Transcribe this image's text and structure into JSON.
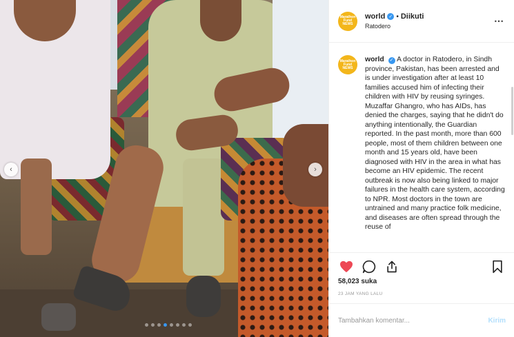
{
  "post": {
    "username": "world",
    "follow_sep": "•",
    "follow_status": "Diikuti",
    "location": "Ratodero",
    "avatar_text": "Marathon Fund NEWS",
    "caption_user": "world",
    "caption_text": "A doctor in Ratodero, in Sindh province, Pakistan, has been arrested and is under investigation after at least 10 families accused him of infecting their children with HIV by reusing syringes. Muzaffar Ghangro, who has AIDs, has denied the charges, saying that he didn't do anything intentionally, the Guardian reported. In the past month, more than 600 people, most of them children between one month and 15 years old, have been diagnosed with HIV in the area in what has become an HIV epidemic. The recent outbreak is now also being linked to major failures in the health care system, according to NPR. Most doctors in the town are untrained and many practice folk medicine, and diseases are often spread through the reuse of",
    "likes": "58,023 suka",
    "timestamp": "23 JAM YANG LALU",
    "comment_placeholder": "Tambahkan komentar...",
    "post_button": "Kirim"
  },
  "icons": {
    "more": "⋯",
    "verified": "✓",
    "prev": "‹",
    "next": "›"
  },
  "carousel": {
    "total": 8,
    "active_index": 3
  },
  "colors": {
    "like": "#ed4956",
    "verified": "#3897f0",
    "avatar": "#f3b61b",
    "post_button": "#b2dffc"
  }
}
